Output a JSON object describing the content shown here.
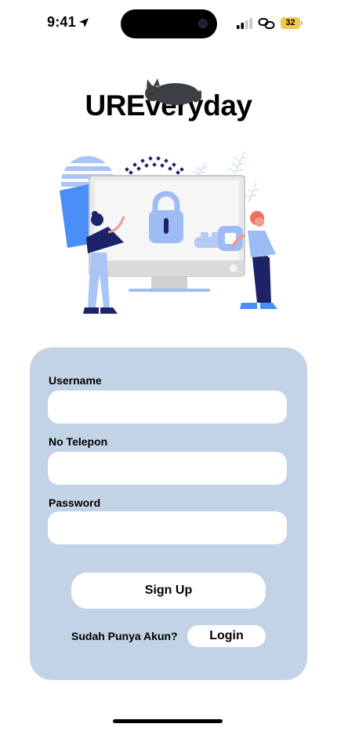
{
  "status_bar": {
    "time": "9:41",
    "battery": "32",
    "location_icon": "location-arrow-icon",
    "signal_icon": "cellular-signal-icon",
    "link_icon": "personal-hotspot-icon"
  },
  "app": {
    "logo": "UREveryday",
    "logo_decoration": "sleeping-cat-icon",
    "illustration": "security-lock-computer-illustration"
  },
  "form": {
    "username_label": "Username",
    "username_value": "",
    "phone_label": "No Telepon",
    "phone_value": "",
    "password_label": "Password",
    "password_value": "",
    "signup_label": "Sign Up",
    "have_account_text": "Sudah Punya Akun?",
    "login_label": "Login"
  },
  "colors": {
    "card_background": "#c2d3e6",
    "input_background": "#ffffff",
    "accent_blue": "#4a8ef7",
    "light_blue": "#9dbcf5",
    "navy": "#1d2366",
    "battery": "#f2c94c"
  }
}
